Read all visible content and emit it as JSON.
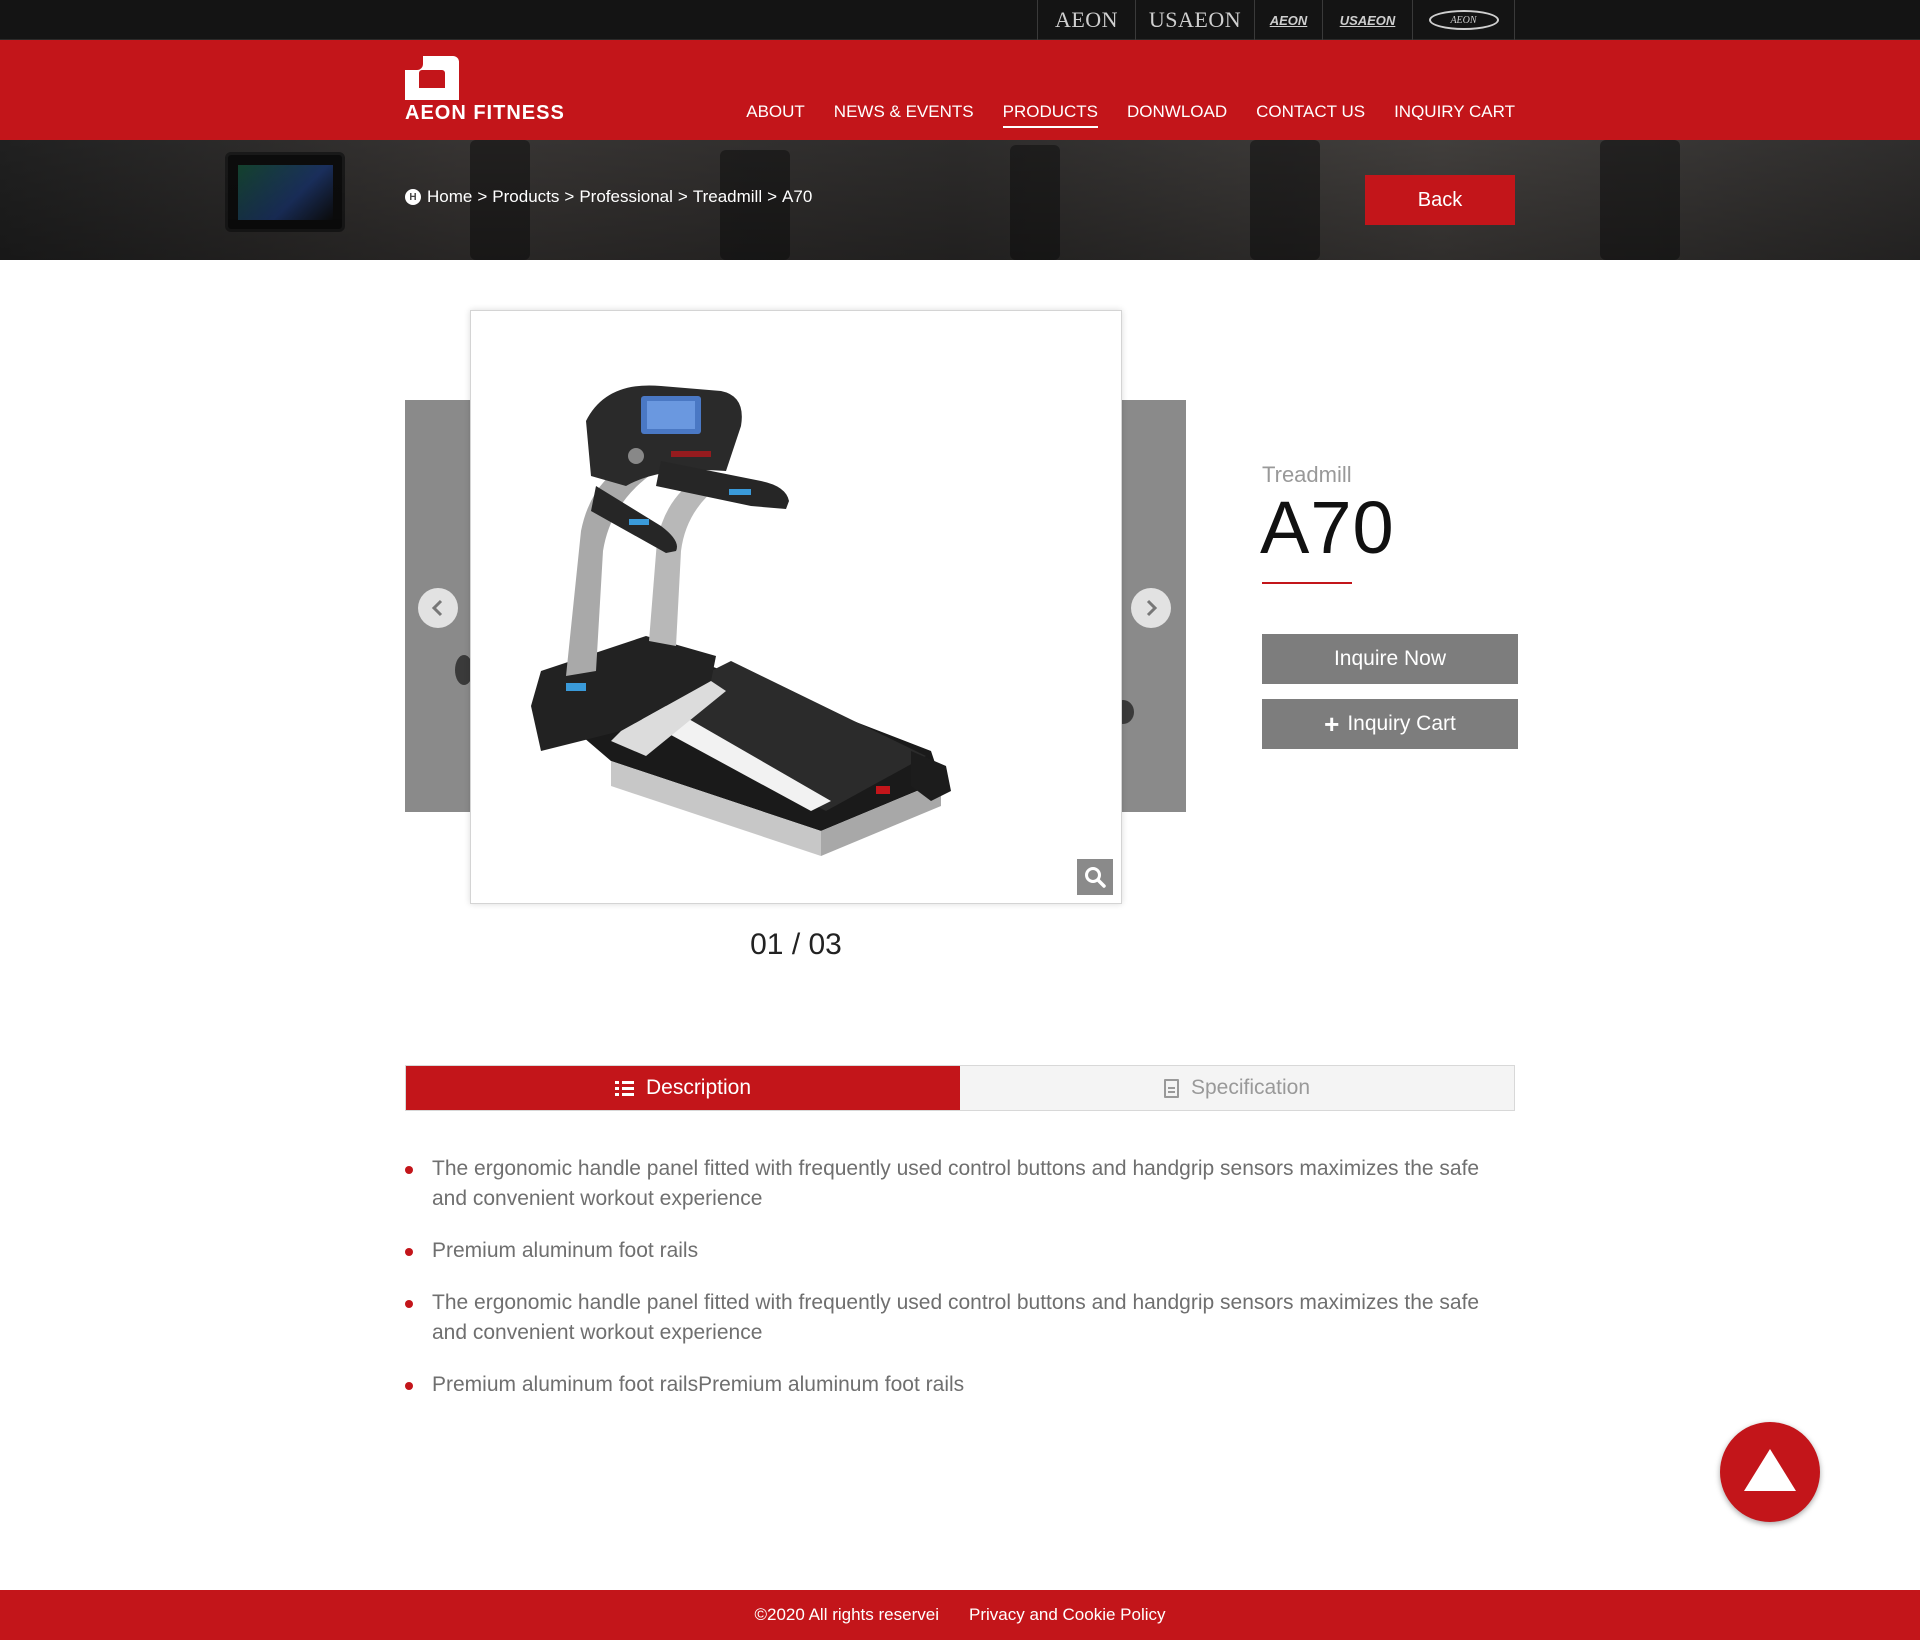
{
  "topbar": {
    "brands": [
      {
        "label": "AEON",
        "style": "serif"
      },
      {
        "label": "USAEON",
        "style": "serif"
      },
      {
        "label": "AEON",
        "style": "italic-mark"
      },
      {
        "label": "USAEON",
        "style": "italic-mark"
      },
      {
        "label": "AEON",
        "style": "oval-mark"
      }
    ]
  },
  "header": {
    "logo_text": "AEON FITNESS",
    "nav": [
      "ABOUT",
      "NEWS & EVENTS",
      "PRODUCTS",
      "DONWLOAD",
      "CONTACT US",
      "INQUIRY CART"
    ],
    "active_nav": "PRODUCTS",
    "brand_color": "#c3151a"
  },
  "breadcrumb": {
    "home_icon": "H",
    "items": [
      "Home",
      "Products",
      "Professional",
      "Treadmill",
      "A70"
    ],
    "separator": ">"
  },
  "banner": {
    "back_label": "Back"
  },
  "gallery": {
    "counter": "01 / 03",
    "prev_icon": "chevron-left-icon",
    "next_icon": "chevron-right-icon",
    "zoom_icon": "search-icon"
  },
  "product": {
    "category": "Treadmill",
    "model": "A70",
    "inquire_label": "Inquire Now",
    "cart_label": "Inquiry Cart"
  },
  "tabs": {
    "description": "Description",
    "specification": "Specification"
  },
  "description_items": [
    "The ergonomic handle panel fitted with frequently used control buttons and handgrip sensors maximizes the safe and convenient workout experience",
    "Premium aluminum foot rails",
    "The ergonomic handle panel fitted with frequently used control buttons and handgrip sensors maximizes the safe and convenient workout experience",
    "Premium aluminum foot railsPremium aluminum foot rails"
  ],
  "footer": {
    "copyright": "©2020 All rights reservei",
    "privacy": "Privacy and Cookie Policy"
  }
}
